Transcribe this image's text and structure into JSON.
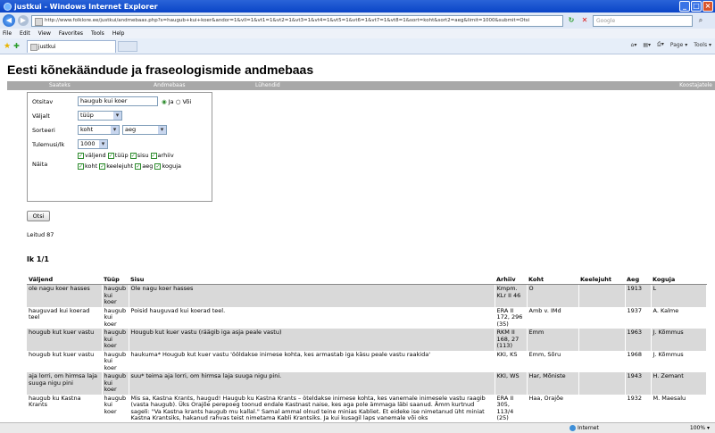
{
  "window": {
    "title": "justkui - Windows Internet Explorer",
    "url": "http://www.folklore.ee/justkui/andmebaas.php?s=haugub+kui+koer&andor=1&vll=1&vt1=1&vt2=1&vt3=1&vt4=1&vt5=1&vt6=1&vt7=1&vt8=1&sort=koht&sort2=aeg&limit=1000&submit=Otsi",
    "search_placeholder": "Google",
    "menu": [
      "File",
      "Edit",
      "View",
      "Favorites",
      "Tools",
      "Help"
    ],
    "tab_label": "justkui",
    "tools": [
      "Page ▾",
      "Tools ▾"
    ]
  },
  "page": {
    "title": "Eesti kõnekäändude ja fraseologismide andmebaas",
    "nav": [
      "Saateks",
      "Andmebaas",
      "Lühendid"
    ],
    "nav_right": "Koostajatele"
  },
  "form": {
    "otsitav_label": "Otsitav",
    "otsitav_value": "haugub kui koer",
    "ja_label": "Ja",
    "voi_label": "Või",
    "valjalt_label": "Väljalt",
    "valjalt_value": "tüüp",
    "sorteeri_label": "Sorteeri",
    "sort1": "koht",
    "sort2": "aeg",
    "tulemusi_label": "Tulemusi/lk",
    "tulemusi_value": "1000",
    "naita_label": "Näita",
    "show_row1": [
      "väljend",
      "tüüp",
      "sisu",
      "arhiiv"
    ],
    "show_row2": [
      "koht",
      "keelejuht",
      "aeg",
      "koguja"
    ],
    "submit": "Otsi"
  },
  "results_info": {
    "found": "Leitud 87",
    "page": "lk 1/1"
  },
  "table": {
    "headers": [
      "Väljend",
      "Tüüp",
      "Sisu",
      "Arhiiv",
      "Koht",
      "Keelejuht",
      "Aeg",
      "Koguja"
    ],
    "rows": [
      [
        "ole nagu koer hasses",
        "haugub kui koer",
        "Ole nagu koer hasses",
        "Kmpm. KLr II 46",
        "O",
        "",
        "1913",
        "L"
      ],
      [
        "hauguvad kui koerad teel",
        "haugub kui koer",
        "Poisid hauguvad kui koerad teel.",
        "ERA II 172, 296 (35)",
        "Amb v. IMd",
        "",
        "1937",
        "A. Kalme"
      ],
      [
        "hougub kut kuer vastu",
        "haugub kui koer",
        "Hougub kut kuer vastu (räägib iga asja peale vastu)",
        "RKM II 168, 27 (113)",
        "Emm",
        "",
        "1963",
        "J. Kõmmus"
      ],
      [
        "hougub kut kuer vastu",
        "haugub kui koer",
        "haukuma* Hougub kut kuer vastu 'ööldakse inimese kohta, kes armastab iga käsu peale vastu raakida'",
        "KKI, KS",
        "Emm, Sõru",
        "",
        "1968",
        "J. Kõmmus"
      ],
      [
        "aja lorri, om hirmsa laja suuga nigu pini",
        "haugub kui koer",
        "suu* teima aja lorri, om hirmsa laja suuga nigu pini.",
        "KKI, WS",
        "Har, Mõniste",
        "",
        "1943",
        "H. Zemant"
      ],
      [
        "haugub ku Kastna Krants",
        "haugub kui koer",
        "Mis sa, Kastna Krants, haugud! Haugub ku Kastna Krants – öteldakse inimese kohta, kes vanemale inimesele vastu raagib (vasta haugub). Üks Orajõe perepoeg toonud endale Kastnast naise, kes aga pole ämmaga läbi saanud. Ämm kurtnud sageli: \"Va Kastna krants haugub mu kallal.\" Samal ammal olnud teine minias Kabliet. Et eideke ise nimetanud üht miniat Kastna Krantsiks, hakanud rahvas teist nimetama Kabli Krantsiks. Ja kui kusagil laps vanemale või oks",
        "ERA II 305, 113/4 (25)",
        "Haa, Orajõe",
        "",
        "1932",
        "M. Maesalu"
      ]
    ]
  },
  "statusbar": {
    "zone": "Internet",
    "zoom": "100% ▾"
  }
}
